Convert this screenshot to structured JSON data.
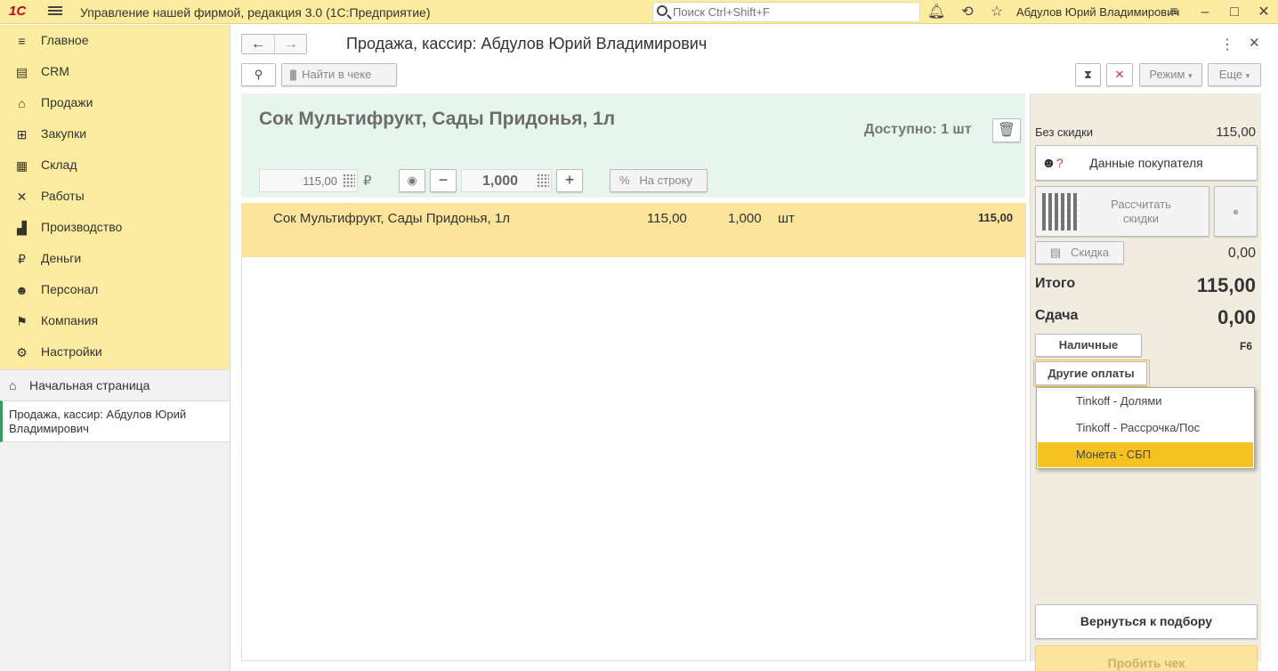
{
  "topbar": {
    "logo": "1С",
    "app_title": "Управление нашей фирмой, редакция 3.0  (1С:Предприятие)",
    "search_placeholder": "Поиск Ctrl+Shift+F",
    "user": "Абдулов Юрий Владимирович"
  },
  "sidebar": {
    "items": [
      {
        "label": "Главное",
        "icon": "menu-list-icon",
        "glyph": "≡"
      },
      {
        "label": "CRM",
        "icon": "contacts-icon",
        "glyph": "▤"
      },
      {
        "label": "Продажи",
        "icon": "basket-icon",
        "glyph": "⌂"
      },
      {
        "label": "Закупки",
        "icon": "cart-icon",
        "glyph": "⊞"
      },
      {
        "label": "Склад",
        "icon": "warehouse-icon",
        "glyph": "▦"
      },
      {
        "label": "Работы",
        "icon": "tools-icon",
        "glyph": "✕"
      },
      {
        "label": "Производство",
        "icon": "factory-icon",
        "glyph": "▟"
      },
      {
        "label": "Деньги",
        "icon": "ruble-coin-icon",
        "glyph": "₽"
      },
      {
        "label": "Персонал",
        "icon": "people-icon",
        "glyph": "☻"
      },
      {
        "label": "Компания",
        "icon": "flag-icon",
        "glyph": "⚑"
      },
      {
        "label": "Настройки",
        "icon": "gear-icon",
        "glyph": "⚙"
      }
    ],
    "home": "Начальная страница",
    "open_doc": "Продажа, кассир: Абдулов Юрий Владимирович"
  },
  "form": {
    "title": "Продажа, кассир: Абдулов Юрий Владимирович",
    "find_in_receipt": "Найти в чеке",
    "mode": "Режим",
    "more": "Еще"
  },
  "product": {
    "name": "Сок Мультифрукт, Сады Придонья, 1л",
    "available": "Доступно: 1 шт",
    "price": "115,00",
    "currency": "₽",
    "qty": "1,000",
    "per_line_symbol": "%",
    "per_line": "На строку"
  },
  "rows": [
    {
      "name": "Сок Мультифрукт, Сады Придонья, 1л",
      "price": "115,00",
      "qty": "1,000",
      "unit": "шт",
      "sum": "115,00"
    }
  ],
  "right": {
    "no_discount_label": "Без скидки",
    "no_discount_value": "115,00",
    "customer_data": "Данные покупателя",
    "calc_discounts": "Рассчитать скидки",
    "discount_label": "Скидка",
    "discount_value": "0,00",
    "total_label": "Итого",
    "total_value": "115,00",
    "change_label": "Сдача",
    "change_value": "0,00",
    "cash": "Наличные",
    "cash_key": "F6",
    "other_payments": "Другие оплаты",
    "payment_options": [
      "Tinkoff - Долями",
      "Tinkoff - Рассрочка/Пос",
      "Монета - СБП"
    ],
    "selected_option": "Монета - СБП",
    "back_to_selection": "Вернуться к подбору",
    "print_receipt": "Пробить чек"
  },
  "colors": {
    "accent": "#fbec9f",
    "selected": "#f6c21f",
    "row_highlight": "#fbe59b",
    "banner": "#e6f5ee"
  }
}
